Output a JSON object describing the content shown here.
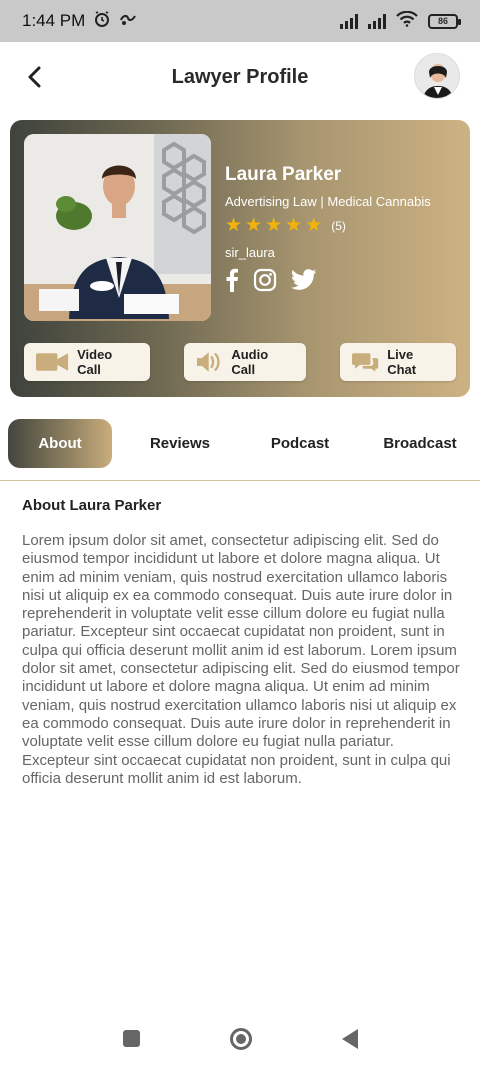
{
  "status_bar": {
    "time": "1:44 PM",
    "battery": "86"
  },
  "header": {
    "title": "Lawyer Profile"
  },
  "profile": {
    "name": "Laura Parker",
    "specialty": "Advertising Law | Medical Cannabis",
    "rating_stars": 5,
    "rating_count": "(5)",
    "username": "sir_laura"
  },
  "actions": {
    "video_call": "Video Call",
    "audio_call": "Audio Call",
    "live_chat": "Live Chat"
  },
  "tabs": {
    "about": "About",
    "reviews": "Reviews",
    "podcast": "Podcast",
    "broadcast": "Broadcast"
  },
  "about": {
    "title": "About Laura Parker",
    "text": "Lorem ipsum dolor sit amet, consectetur adipiscing elit. Sed do eiusmod tempor incididunt ut labore et dolore magna aliqua. Ut enim ad minim veniam, quis nostrud exercitation ullamco laboris nisi ut aliquip ex ea commodo consequat. Duis aute irure dolor in reprehenderit in voluptate velit esse cillum dolore eu fugiat nulla pariatur. Excepteur sint occaecat cupidatat non proident, sunt in culpa qui officia deserunt mollit anim id est laborum. Lorem ipsum dolor sit amet, consectetur adipiscing elit. Sed do eiusmod tempor incididunt ut labore et dolore magna aliqua. Ut enim ad minim veniam, quis nostrud exercitation ullamco laboris nisi ut aliquip ex ea commodo consequat. Duis aute irure dolor in reprehenderit in voluptate velit esse cillum dolore eu fugiat nulla pariatur. Excepteur sint occaecat cupidatat non proident, sunt in culpa qui officia deserunt mollit anim id est laborum."
  },
  "colors": {
    "accent_gold": "#c9ad7d",
    "card_dark": "#3f433d",
    "star": "#f2b40c"
  },
  "icons": [
    "alarm-icon",
    "app-icon",
    "signal-icon",
    "wifi-icon",
    "battery-icon",
    "back-arrow-icon",
    "video-camera-icon",
    "speaker-icon",
    "chat-bubbles-icon",
    "facebook-icon",
    "instagram-icon",
    "twitter-icon",
    "star-icon",
    "nav-square-icon",
    "nav-home-icon",
    "nav-back-icon"
  ]
}
